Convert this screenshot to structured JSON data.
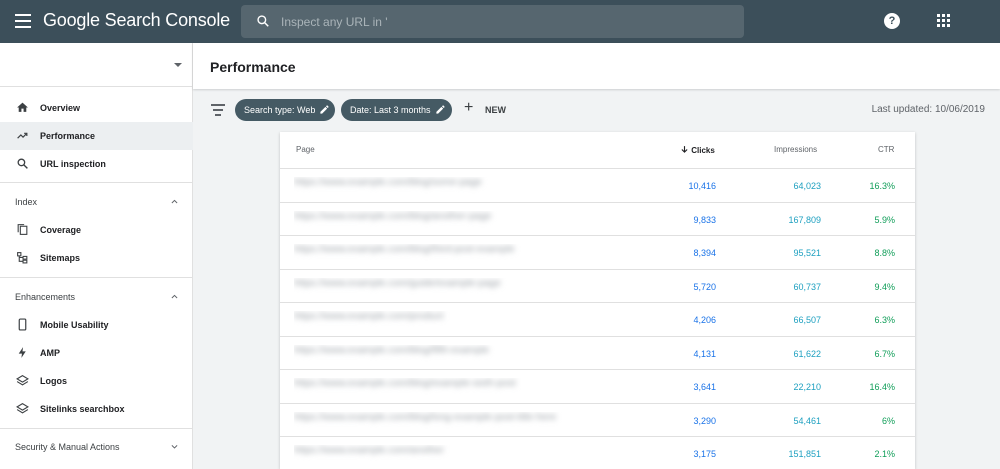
{
  "app": {
    "brand_prefix": "Google",
    "brand_suffix": "Search Console",
    "search_placeholder": "Inspect any URL in '",
    "help_label": "?"
  },
  "sidebar": {
    "items_top": [
      {
        "label": "Overview",
        "icon": "home-icon"
      },
      {
        "label": "Performance",
        "icon": "trending-icon",
        "active": true
      },
      {
        "label": "URL inspection",
        "icon": "search-icon"
      }
    ],
    "index_label": "Index",
    "index_items": [
      {
        "label": "Coverage",
        "icon": "copy-icon"
      },
      {
        "label": "Sitemaps",
        "icon": "sitemap-icon"
      }
    ],
    "enhancements_label": "Enhancements",
    "enhancement_items": [
      {
        "label": "Mobile Usability",
        "icon": "phone-icon"
      },
      {
        "label": "AMP",
        "icon": "bolt-icon"
      },
      {
        "label": "Logos",
        "icon": "layers-icon"
      },
      {
        "label": "Sitelinks searchbox",
        "icon": "layers-icon"
      }
    ],
    "security_label": "Security & Manual Actions"
  },
  "page": {
    "title": "Performance",
    "chips": [
      "Search type: Web",
      "Date: Last 3 months"
    ],
    "new_label": "NEW",
    "last_updated": "Last updated: 10/06/2019"
  },
  "table": {
    "headers": {
      "page": "Page",
      "clicks": "Clicks",
      "impressions": "Impressions",
      "ctr": "CTR"
    },
    "rows": [
      {
        "page": "https://www.example.com/blog/some-page",
        "clicks": "10,416",
        "impressions": "64,023",
        "ctr": "16.3%"
      },
      {
        "page": "https://www.example.com/blog/another-page",
        "clicks": "9,833",
        "impressions": "167,809",
        "ctr": "5.9%"
      },
      {
        "page": "https://www.example.com/blog/third-post-example",
        "clicks": "8,394",
        "impressions": "95,521",
        "ctr": "8.8%"
      },
      {
        "page": "https://www.example.com/guide/example-page",
        "clicks": "5,720",
        "impressions": "60,737",
        "ctr": "9.4%"
      },
      {
        "page": "https://www.example.com/product",
        "clicks": "4,206",
        "impressions": "66,507",
        "ctr": "6.3%"
      },
      {
        "page": "https://www.example.com/blog/fifth-example",
        "clicks": "4,131",
        "impressions": "61,622",
        "ctr": "6.7%"
      },
      {
        "page": "https://www.example.com/blog/example-sixth-post",
        "clicks": "3,641",
        "impressions": "22,210",
        "ctr": "16.4%"
      },
      {
        "page": "https://www.example.com/blog/long-example-post-title-here",
        "clicks": "3,290",
        "impressions": "54,461",
        "ctr": "6%"
      },
      {
        "page": "https://www.example.com/another",
        "clicks": "3,175",
        "impressions": "151,851",
        "ctr": "2.1%"
      }
    ]
  }
}
